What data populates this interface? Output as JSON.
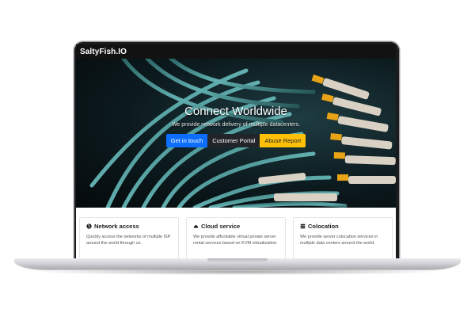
{
  "navbar": {
    "brand": "SaltyFish.IO"
  },
  "hero": {
    "title": "Connect Worldwide",
    "subtitle": "We provide network delivery of multiple datacenters.",
    "buttons": {
      "get_in_touch": "Get in touch",
      "customer_portal": "Customer Portal",
      "abuse_report": "Abuse Report"
    }
  },
  "features": [
    {
      "title": "Network access",
      "text": "Quickly access the networks of multiple ISP around the world through us.",
      "icon": "globe-icon"
    },
    {
      "title": "Cloud service",
      "text": "We provide affordable virtual private server rental services based on KVM virtualization.",
      "icon": "cloud-icon"
    },
    {
      "title": "Colocation",
      "text": "We provide server colocation services in multiple data centers around the world.",
      "icon": "server-icon"
    }
  ],
  "colors": {
    "primary": "#0d6efd",
    "dark": "#212529",
    "warning": "#ffc107",
    "navbar": "#121212",
    "cable": "#5fb3b3",
    "connector": "#e8a317"
  }
}
